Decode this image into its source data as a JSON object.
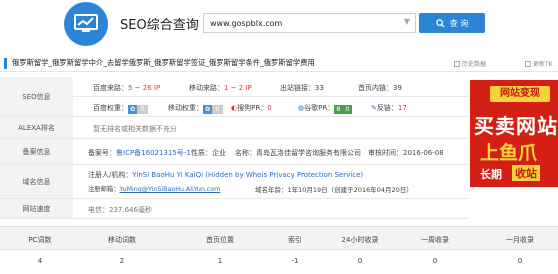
{
  "header": {
    "brand": "SEO综合查询",
    "search_value": "www.gospblx.com",
    "query_button": "查 询"
  },
  "title": {
    "text": "俄罗斯留学_俄罗斯留学中介_去留学俄罗斯_俄罗斯留学签证_俄罗斯留学条件_俄罗斯留学费用",
    "history_label": "历史数据",
    "report_label": "更新TK"
  },
  "seo": {
    "label": "SEO信息",
    "baidu_traffic_label": "百度来路：",
    "baidu_traffic_value": "5 ~ 26 IP",
    "mobile_traffic_label": "移动来路：",
    "mobile_traffic_value": "1 ~ 2 IP",
    "outlinks_label": "出站链接：",
    "outlinks_value": "33",
    "homepage_inner_label": "首页内链：",
    "homepage_inner_value": "39",
    "baidu_weight_label": "百度权重：",
    "baidu_weight_value": "0",
    "mobile_weight_label": "移动权重：",
    "mobile_weight_value": "0",
    "sogou_label": "搜狗PR：",
    "sogou_value": "0",
    "google_label": "谷歌PR：",
    "google_value": "0",
    "backlink_label": "反链：",
    "backlink_value": "17"
  },
  "alexa": {
    "label": "ALEXA排名",
    "text": "暂无排名或相关数据不充分"
  },
  "icp": {
    "label": "备案信息",
    "icp_label": "备案号：",
    "icp_value": "鲁ICP备16021315号-1",
    "nature_label": "性质：",
    "nature_value": "企业",
    "name_label": "名称：",
    "name_value": "青岛瓦洛佳留学咨询服务有限公司",
    "review_label": "审核时间：",
    "review_value": "2016-06-08"
  },
  "domain": {
    "label": "域名信息",
    "registrant_label": "注册人/机构：",
    "registrant_value": "YinSi BaoHu Yi KaiQi (Hidden by Whois Privacy Protection Service)",
    "email_label": "注册邮箱：",
    "email_value": "YuMing@YinSiBaoHu.AliYun.com",
    "age_label": "域名年龄：",
    "age_value": "1年10月19日（创建于2016年04月20日）"
  },
  "speed": {
    "label": "网站速度",
    "text": "电信：237.646毫秒"
  },
  "stats": {
    "headers": [
      "PC词数",
      "移动词数",
      "首页位置",
      "索引",
      "24小时收录",
      "一周收录",
      "一月收录"
    ],
    "values": [
      "4",
      "2",
      "1",
      "-1",
      "0",
      "0",
      "0"
    ]
  },
  "ad": {
    "line1": "网站变现",
    "line2": "买卖网站",
    "line3": "上鱼爪",
    "line4": "长期",
    "line5": "收站"
  },
  "colors": {
    "accent": "#2b84d6",
    "red": "#e4393c",
    "link": "#2b6dc2"
  }
}
